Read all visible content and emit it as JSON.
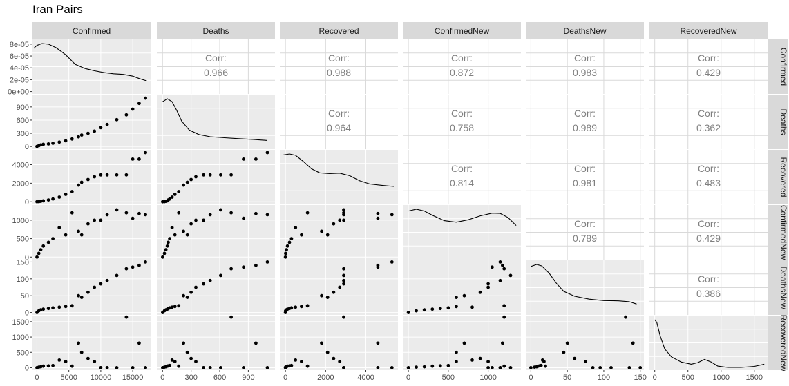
{
  "title": "Iran Pairs",
  "chart_data": {
    "type": "scatter",
    "variables": [
      "Confirmed",
      "Deaths",
      "Recovered",
      "ConfirmedNew",
      "DeathsNew",
      "RecoveredNew"
    ],
    "corr_label": "Corr:",
    "correlations": [
      {
        "row": "Confirmed",
        "col": "Deaths",
        "value": "0.966"
      },
      {
        "row": "Confirmed",
        "col": "Recovered",
        "value": "0.988"
      },
      {
        "row": "Confirmed",
        "col": "ConfirmedNew",
        "value": "0.872"
      },
      {
        "row": "Confirmed",
        "col": "DeathsNew",
        "value": "0.983"
      },
      {
        "row": "Confirmed",
        "col": "RecoveredNew",
        "value": "0.429"
      },
      {
        "row": "Deaths",
        "col": "Recovered",
        "value": "0.964"
      },
      {
        "row": "Deaths",
        "col": "ConfirmedNew",
        "value": "0.758"
      },
      {
        "row": "Deaths",
        "col": "DeathsNew",
        "value": "0.989"
      },
      {
        "row": "Deaths",
        "col": "RecoveredNew",
        "value": "0.362"
      },
      {
        "row": "Recovered",
        "col": "ConfirmedNew",
        "value": "0.814"
      },
      {
        "row": "Recovered",
        "col": "DeathsNew",
        "value": "0.981"
      },
      {
        "row": "Recovered",
        "col": "RecoveredNew",
        "value": "0.483"
      },
      {
        "row": "ConfirmedNew",
        "col": "DeathsNew",
        "value": "0.789"
      },
      {
        "row": "ConfirmedNew",
        "col": "RecoveredNew",
        "value": "0.429"
      },
      {
        "row": "DeathsNew",
        "col": "RecoveredNew",
        "value": "0.386"
      }
    ],
    "x_ticks": [
      [
        0,
        5000,
        10000,
        15000
      ],
      [
        0,
        300,
        600,
        900
      ],
      [
        0,
        2000,
        4000
      ],
      [
        0,
        500,
        1000
      ],
      [
        0,
        50,
        100,
        150
      ],
      [
        0,
        500,
        1000,
        1500
      ]
    ],
    "x_ranges": [
      [
        -700,
        17800
      ],
      [
        -60,
        1180
      ],
      [
        -280,
        5600
      ],
      [
        -70,
        1410
      ],
      [
        -7,
        155
      ],
      [
        -80,
        1700
      ]
    ],
    "y_ticks_row1": {
      "labels": [
        "0e+00",
        "2e-05",
        "4e-05",
        "6e-05",
        "8e-05"
      ],
      "values": [
        0,
        2e-05,
        4e-05,
        6e-05,
        8e-05
      ],
      "range": [
        -4e-06,
        8.8e-05
      ]
    },
    "y_ticks": [
      null,
      [
        0,
        300,
        600,
        900
      ],
      [
        0,
        2000,
        4000
      ],
      [
        0,
        500,
        1000
      ],
      [
        0,
        50,
        100,
        150
      ],
      [
        0,
        500,
        1000,
        1500
      ]
    ],
    "y_ranges": [
      null,
      [
        -60,
        1180
      ],
      [
        -280,
        5600
      ],
      [
        -70,
        1410
      ],
      [
        -7,
        155
      ],
      [
        -80,
        1700
      ]
    ],
    "density_curves": [
      [
        [
          -500,
          7.3e-05
        ],
        [
          0,
          7.8e-05
        ],
        [
          800,
          8.1e-05
        ],
        [
          1800,
          8e-05
        ],
        [
          3000,
          7.4e-05
        ],
        [
          4500,
          6.2e-05
        ],
        [
          6000,
          4.6e-05
        ],
        [
          7500,
          3.9e-05
        ],
        [
          9000,
          3.5e-05
        ],
        [
          10500,
          3.2e-05
        ],
        [
          12000,
          3e-05
        ],
        [
          13500,
          2.9e-05
        ],
        [
          15000,
          2.6e-05
        ],
        [
          16000,
          2.2e-05
        ],
        [
          17200,
          1.8e-05
        ]
      ],
      [
        [
          0,
          0.003
        ],
        [
          50,
          0.0032
        ],
        [
          100,
          0.003
        ],
        [
          150,
          0.0024
        ],
        [
          200,
          0.0017
        ],
        [
          280,
          0.0011
        ],
        [
          380,
          0.0008
        ],
        [
          500,
          0.00065
        ],
        [
          650,
          0.00058
        ],
        [
          800,
          0.00052
        ],
        [
          950,
          0.00047
        ],
        [
          1100,
          0.0004
        ]
      ],
      [
        [
          -100,
          0.000292
        ],
        [
          200,
          0.000298
        ],
        [
          500,
          0.00029
        ],
        [
          900,
          0.00025
        ],
        [
          1300,
          0.000205
        ],
        [
          1700,
          0.00018
        ],
        [
          2200,
          0.000175
        ],
        [
          2700,
          0.000178
        ],
        [
          3200,
          0.000162
        ],
        [
          3700,
          0.00013
        ],
        [
          4200,
          0.00011
        ],
        [
          4800,
          0.000102
        ],
        [
          5400,
          9.5e-05
        ]
      ],
      [
        [
          0,
          0.00076
        ],
        [
          100,
          0.00079
        ],
        [
          200,
          0.00076
        ],
        [
          300,
          0.00069
        ],
        [
          450,
          0.0006
        ],
        [
          600,
          0.000575
        ],
        [
          750,
          0.000615
        ],
        [
          900,
          0.00068
        ],
        [
          1050,
          0.000725
        ],
        [
          1150,
          0.00072
        ],
        [
          1250,
          0.00065
        ],
        [
          1350,
          0.00052
        ]
      ],
      [
        [
          0,
          0.0158
        ],
        [
          8,
          0.0165
        ],
        [
          15,
          0.016
        ],
        [
          25,
          0.0135
        ],
        [
          35,
          0.01
        ],
        [
          45,
          0.0072
        ],
        [
          60,
          0.0055
        ],
        [
          80,
          0.0045
        ],
        [
          100,
          0.004
        ],
        [
          120,
          0.0039
        ],
        [
          135,
          0.0036
        ],
        [
          145,
          0.0028
        ]
      ],
      [
        [
          0,
          0.0018
        ],
        [
          30,
          0.0017
        ],
        [
          80,
          0.0012
        ],
        [
          150,
          0.0007
        ],
        [
          250,
          0.0004
        ],
        [
          400,
          0.0002
        ],
        [
          550,
          0.00012
        ],
        [
          650,
          0.00018
        ],
        [
          750,
          0.0003
        ],
        [
          850,
          0.0002
        ],
        [
          950,
          5e-05
        ],
        [
          1100,
          0.0
        ],
        [
          1300,
          0.0
        ],
        [
          1500,
          4e-05
        ],
        [
          1650,
          0.00012
        ]
      ]
    ],
    "observations": [
      [
        0,
        1,
        0,
        0,
        0,
        0
      ],
      [
        300,
        20,
        10,
        100,
        5,
        20
      ],
      [
        600,
        35,
        50,
        200,
        8,
        30
      ],
      [
        1000,
        50,
        100,
        300,
        10,
        50
      ],
      [
        1800,
        60,
        200,
        400,
        12,
        60
      ],
      [
        2500,
        75,
        300,
        500,
        14,
        70
      ],
      [
        3500,
        100,
        500,
        800,
        16,
        250
      ],
      [
        4500,
        130,
        800,
        600,
        18,
        200
      ],
      [
        5500,
        170,
        1100,
        1200,
        20,
        50
      ],
      [
        6500,
        220,
        1800,
        700,
        50,
        800
      ],
      [
        7000,
        260,
        2100,
        600,
        45,
        500
      ],
      [
        8000,
        300,
        2400,
        900,
        60,
        300
      ],
      [
        9000,
        350,
        2700,
        1000,
        75,
        200
      ],
      [
        10000,
        430,
        2900,
        1000,
        85,
        0
      ],
      [
        11000,
        500,
        2900,
        1150,
        95,
        0
      ],
      [
        12500,
        610,
        2900,
        1280,
        110,
        0
      ],
      [
        14000,
        720,
        2900,
        1200,
        130,
        1650
      ],
      [
        15000,
        850,
        4600,
        1050,
        135,
        0
      ],
      [
        16000,
        980,
        4600,
        1180,
        140,
        800
      ],
      [
        17000,
        1100,
        5300,
        1150,
        150,
        0
      ]
    ]
  }
}
